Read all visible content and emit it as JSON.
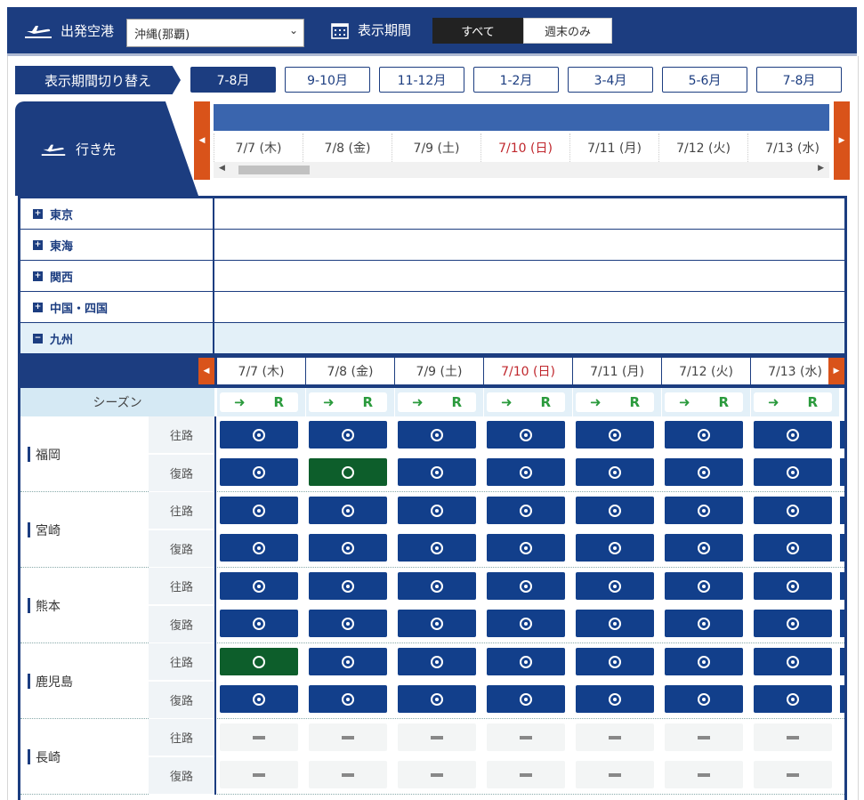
{
  "header": {
    "departure_label": "出発空港",
    "departure_value": "沖縄(那覇)",
    "period_label": "表示期間",
    "toggle_all": "すべて",
    "toggle_weekend": "週末のみ"
  },
  "period_switch": {
    "label": "表示期間切り替え",
    "tabs": [
      "7-8月",
      "9-10月",
      "11-12月",
      "1-2月",
      "3-4月",
      "5-6月",
      "7-8月"
    ],
    "active_index": 0
  },
  "destination_label": "行き先",
  "dates": [
    {
      "label": "7/7 (木)",
      "sun": false
    },
    {
      "label": "7/8 (金)",
      "sun": false
    },
    {
      "label": "7/9 (土)",
      "sun": false
    },
    {
      "label": "7/10 (日)",
      "sun": true
    },
    {
      "label": "7/11 (月)",
      "sun": false
    },
    {
      "label": "7/12 (火)",
      "sun": false
    },
    {
      "label": "7/13 (水)",
      "sun": false
    }
  ],
  "regions": [
    {
      "name": "東京",
      "sign": "+"
    },
    {
      "name": "東海",
      "sign": "+"
    },
    {
      "name": "関西",
      "sign": "+"
    },
    {
      "name": "中国・四国",
      "sign": "+"
    },
    {
      "name": "九州",
      "sign": "−"
    }
  ],
  "season_label": "シーズン",
  "season_marks": {
    "arrow": "➜",
    "r": "R"
  },
  "dir_out": "往路",
  "dir_back": "復路",
  "colors": {
    "navy": "#1c3d80",
    "blue_cell": "#123f8b",
    "green_cell": "#0d5e2b",
    "orange_nav": "#d9531a",
    "sunday": "#c0272d"
  },
  "routes": [
    {
      "name": "福岡",
      "out": [
        "b",
        "b",
        "b",
        "b",
        "b",
        "b",
        "b"
      ],
      "back": [
        "b",
        "g",
        "b",
        "b",
        "b",
        "b",
        "b"
      ]
    },
    {
      "name": "宮崎",
      "out": [
        "b",
        "b",
        "b",
        "b",
        "b",
        "b",
        "b"
      ],
      "back": [
        "b",
        "b",
        "b",
        "b",
        "b",
        "b",
        "b"
      ]
    },
    {
      "name": "熊本",
      "out": [
        "b",
        "b",
        "b",
        "b",
        "b",
        "b",
        "b"
      ],
      "back": [
        "b",
        "b",
        "b",
        "b",
        "b",
        "b",
        "b"
      ]
    },
    {
      "name": "鹿児島",
      "out": [
        "g",
        "b",
        "b",
        "b",
        "b",
        "b",
        "b"
      ],
      "back": [
        "b",
        "b",
        "b",
        "b",
        "b",
        "b",
        "b"
      ]
    },
    {
      "name": "長崎",
      "out": [
        "x",
        "x",
        "x",
        "x",
        "x",
        "x",
        "x"
      ],
      "back": [
        "x",
        "x",
        "x",
        "x",
        "x",
        "x",
        "x"
      ]
    }
  ]
}
